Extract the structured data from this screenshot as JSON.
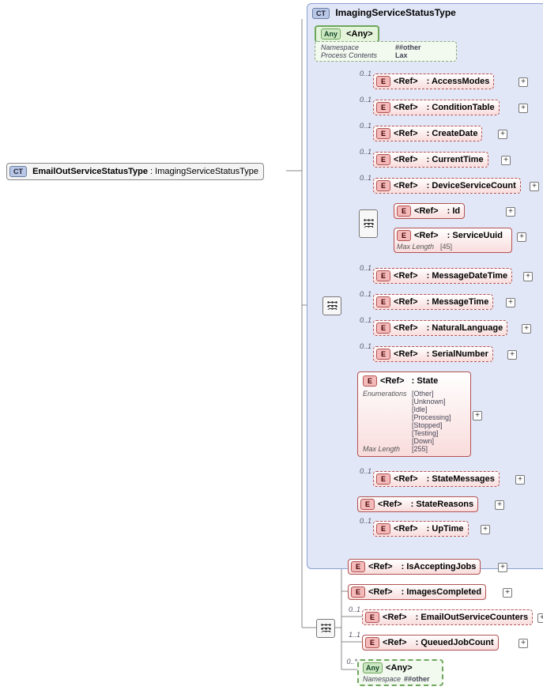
{
  "root": {
    "badge": "CT",
    "name": "EmailOutServiceStatusType",
    "sep": " : ",
    "ext": "ImagingServiceStatusType"
  },
  "typeFrame": {
    "badge": "CT",
    "title": "ImagingServiceStatusType"
  },
  "anyTop": {
    "badge": "Any",
    "label": "<Any>",
    "rows": [
      {
        "k": "Namespace",
        "v": "##other"
      },
      {
        "k": "Process Contents",
        "v": "Lax"
      }
    ]
  },
  "cards": {
    "c01": "0..1",
    "c11": "1..1",
    "c0s": "0..*"
  },
  "refTag": "<Ref>",
  "eBadge": "E",
  "sep": " : ",
  "refs": {
    "accessModes": "AccessModes",
    "conditionTable": "ConditionTable",
    "createDate": "CreateDate",
    "currentTime": "CurrentTime",
    "deviceServiceCount": "DeviceServiceCount",
    "id": "Id",
    "serviceUuid": "ServiceUuid",
    "serviceUuidMaxLenK": "Max Length",
    "serviceUuidMaxLenV": "[45]",
    "messageDateTime": "MessageDateTime",
    "messageTime": "MessageTime",
    "naturalLanguage": "NaturalLanguage",
    "serialNumber": "SerialNumber",
    "stateName": "State",
    "stateEnumK": "Enumerations",
    "stateEnums": [
      "[Other]",
      "[Unknown]",
      "[Idle]",
      "[Processing]",
      "[Stopped]",
      "[Testing]",
      "[Down]"
    ],
    "stateMaxLenK": "Max Length",
    "stateMaxLenV": "[255]",
    "stateMessages": "StateMessages",
    "stateReasons": "StateReasons",
    "upTime": "UpTime"
  },
  "bottom": {
    "isAcceptingJobs": "IsAcceptingJobs",
    "imagesCompleted": "ImagesCompleted",
    "emailOutServiceCounters": "EmailOutServiceCounters",
    "queuedJobCount": "QueuedJobCount",
    "anyBadge": "Any",
    "anyLabel": "<Any>",
    "anyNsK": "Namespace",
    "anyNsV": "##other"
  }
}
